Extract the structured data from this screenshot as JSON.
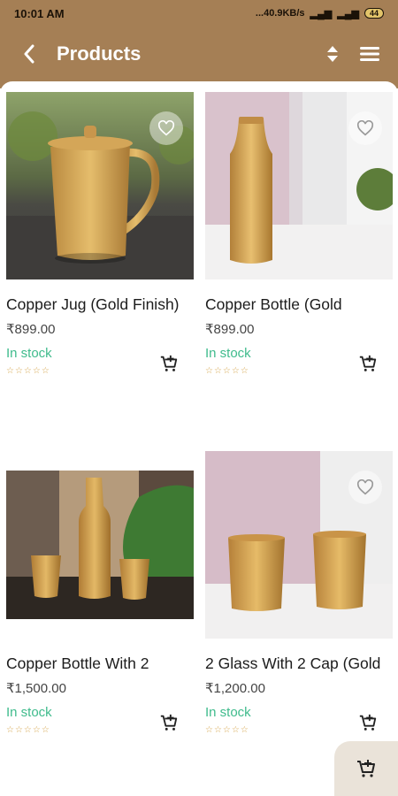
{
  "status_bar": {
    "time": "10:01 AM",
    "network_speed": "...40.9KB/s",
    "battery": "44"
  },
  "header": {
    "title": "Products",
    "back_icon": "chevron-left-icon",
    "sort_icon": "sort-icon",
    "menu_icon": "hamburger-menu-icon"
  },
  "products": [
    {
      "name": "Copper Jug (Gold Finish)",
      "price": "₹899.00",
      "stock": "In stock",
      "stars": "☆☆☆☆☆"
    },
    {
      "name": "Copper Bottle (Gold",
      "price": "₹899.00",
      "stock": "In stock",
      "stars": "☆☆☆☆☆"
    },
    {
      "name": "Copper Bottle With 2",
      "price": "₹1,500.00",
      "stock": "In stock",
      "stars": "☆☆☆☆☆"
    },
    {
      "name": "2 Glass With 2 Cap (Gold",
      "price": "₹1,200.00",
      "stock": "In stock",
      "stars": "☆☆☆☆☆"
    }
  ],
  "colors": {
    "app_bar": "#a57f55",
    "in_stock": "#3fbb8c",
    "star": "#d6a64d"
  }
}
